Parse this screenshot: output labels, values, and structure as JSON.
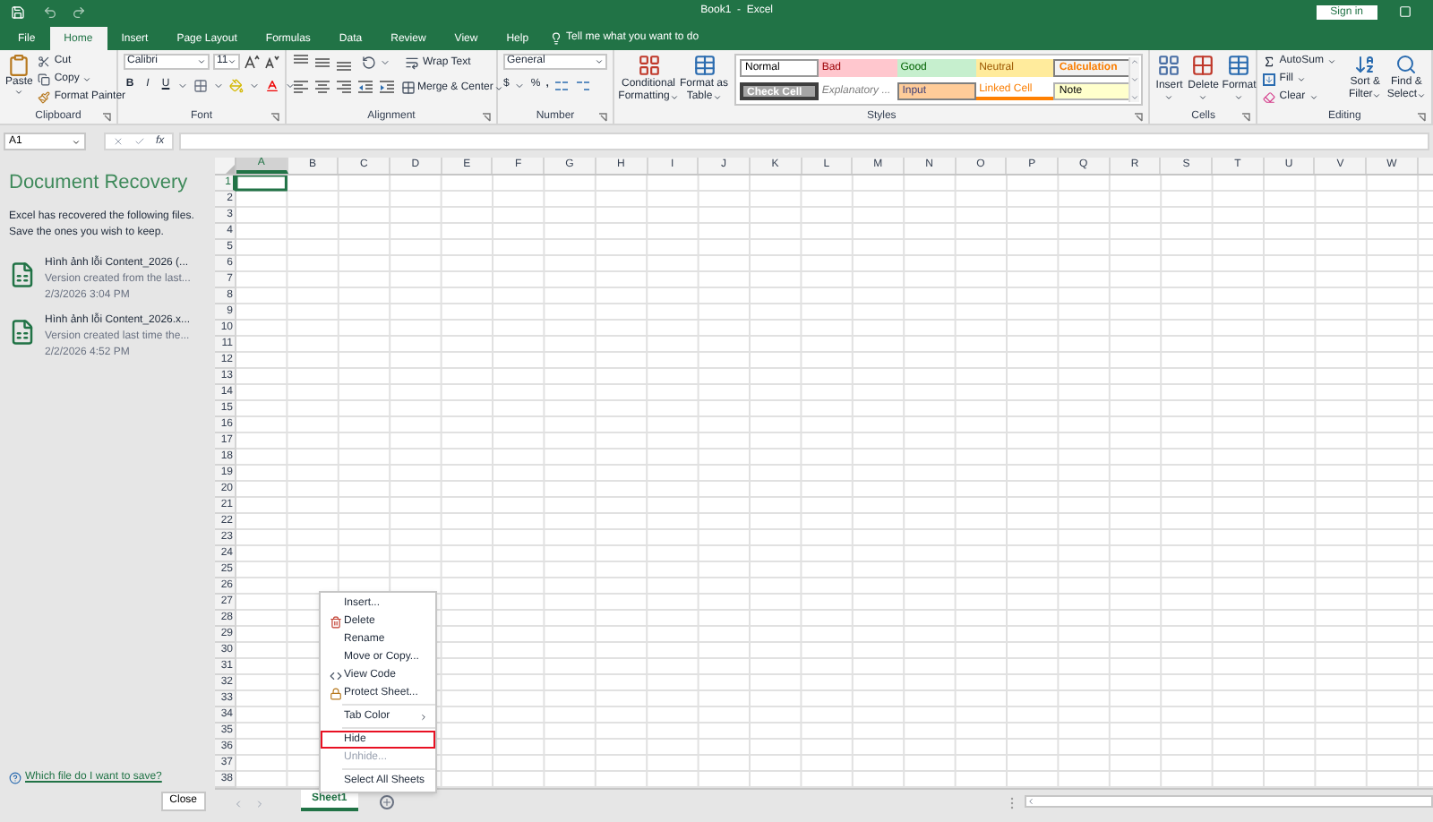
{
  "title_bar": {
    "title": "Book1  -  Excel",
    "sign_in": "Sign in"
  },
  "menu_tabs": [
    {
      "label": "File",
      "selected": false
    },
    {
      "label": "Home",
      "selected": true
    },
    {
      "label": "Insert",
      "selected": false
    },
    {
      "label": "Page Layout",
      "selected": false
    },
    {
      "label": "Formulas",
      "selected": false
    },
    {
      "label": "Data",
      "selected": false
    },
    {
      "label": "Review",
      "selected": false
    },
    {
      "label": "View",
      "selected": false
    },
    {
      "label": "Help",
      "selected": false
    }
  ],
  "tell_me": "Tell me what you want to do",
  "ribbon": {
    "clipboard": {
      "label": "Clipboard",
      "paste": "Paste",
      "cut": "Cut",
      "copy": "Copy",
      "format_painter": "Format Painter"
    },
    "font": {
      "label": "Font",
      "font_name": "Calibri",
      "font_size": "11",
      "bold": "B",
      "italic": "I",
      "underline": "U"
    },
    "alignment": {
      "label": "Alignment",
      "wrap_text": "Wrap Text",
      "merge": "Merge & Center"
    },
    "number": {
      "label": "Number",
      "format": "General",
      "currency": "$",
      "percent": "%",
      "comma": ","
    },
    "styles": {
      "label": "Styles",
      "conditional": [
        "Conditional",
        "Formatting"
      ],
      "format_table": [
        "Format as",
        "Table"
      ],
      "cell_styles": [
        {
          "label": "Normal",
          "kind": "normal"
        },
        {
          "label": "Bad",
          "kind": "bad"
        },
        {
          "label": "Good",
          "kind": "good"
        },
        {
          "label": "Neutral",
          "kind": "neutral"
        },
        {
          "label": "Calculation",
          "kind": "calculation"
        },
        {
          "label": "Check Cell",
          "kind": "check"
        },
        {
          "label": "Explanatory ...",
          "kind": "explanatory"
        },
        {
          "label": "Input",
          "kind": "input"
        },
        {
          "label": "Linked Cell",
          "kind": "linked"
        },
        {
          "label": "Note",
          "kind": "note"
        }
      ]
    },
    "cells": {
      "label": "Cells",
      "buttons": [
        {
          "label": "Insert",
          "kind": "insert"
        },
        {
          "label": "Delete",
          "kind": "delete"
        },
        {
          "label": "Format",
          "kind": "format"
        }
      ]
    },
    "editing": {
      "label": "Editing",
      "autosum": "AutoSum",
      "fill": "Fill",
      "clear": "Clear",
      "sort": [
        "Sort &",
        "Filter"
      ],
      "find": [
        "Find &",
        "Select"
      ]
    }
  },
  "formula_bar": {
    "name_box": "A1",
    "fx": "fx"
  },
  "recovery": {
    "title": "Document Recovery",
    "description": "Excel has recovered the following files.  Save the ones you wish to keep.",
    "files": [
      {
        "name": "Hình ảnh lỗi Content_2026 (...",
        "detail": "Version created from the last...",
        "date": "2/3/2026 3:04 PM"
      },
      {
        "name": "Hình ảnh lỗi Content_2026.x...",
        "detail": "Version created last time the...",
        "date": "2/2/2026 4:52 PM"
      }
    ],
    "help_link": "Which file do I want to save?",
    "close": "Close"
  },
  "grid": {
    "columns": [
      {
        "label": "A",
        "selected": true
      },
      {
        "label": "B",
        "selected": false
      },
      {
        "label": "C",
        "selected": false
      },
      {
        "label": "D",
        "selected": false
      },
      {
        "label": "E",
        "selected": false
      },
      {
        "label": "F",
        "selected": false
      },
      {
        "label": "G",
        "selected": false
      },
      {
        "label": "H",
        "selected": false
      },
      {
        "label": "I",
        "selected": false
      },
      {
        "label": "J",
        "selected": false
      },
      {
        "label": "K",
        "selected": false
      },
      {
        "label": "L",
        "selected": false
      },
      {
        "label": "M",
        "selected": false
      },
      {
        "label": "N",
        "selected": false
      },
      {
        "label": "O",
        "selected": false
      },
      {
        "label": "P",
        "selected": false
      },
      {
        "label": "Q",
        "selected": false
      },
      {
        "label": "R",
        "selected": false
      },
      {
        "label": "S",
        "selected": false
      },
      {
        "label": "T",
        "selected": false
      },
      {
        "label": "U",
        "selected": false
      },
      {
        "label": "V",
        "selected": false
      },
      {
        "label": "W",
        "selected": false
      }
    ],
    "rows": [
      {
        "label": "1",
        "selected": true
      },
      {
        "label": "2",
        "selected": false
      },
      {
        "label": "3",
        "selected": false
      },
      {
        "label": "4",
        "selected": false
      },
      {
        "label": "5",
        "selected": false
      },
      {
        "label": "6",
        "selected": false
      },
      {
        "label": "7",
        "selected": false
      },
      {
        "label": "8",
        "selected": false
      },
      {
        "label": "9",
        "selected": false
      },
      {
        "label": "10",
        "selected": false
      },
      {
        "label": "11",
        "selected": false
      },
      {
        "label": "12",
        "selected": false
      },
      {
        "label": "13",
        "selected": false
      },
      {
        "label": "14",
        "selected": false
      },
      {
        "label": "15",
        "selected": false
      },
      {
        "label": "16",
        "selected": false
      },
      {
        "label": "17",
        "selected": false
      },
      {
        "label": "18",
        "selected": false
      },
      {
        "label": "19",
        "selected": false
      },
      {
        "label": "20",
        "selected": false
      },
      {
        "label": "21",
        "selected": false
      },
      {
        "label": "22",
        "selected": false
      },
      {
        "label": "23",
        "selected": false
      },
      {
        "label": "24",
        "selected": false
      },
      {
        "label": "25",
        "selected": false
      },
      {
        "label": "26",
        "selected": false
      },
      {
        "label": "27",
        "selected": false
      },
      {
        "label": "28",
        "selected": false
      },
      {
        "label": "29",
        "selected": false
      },
      {
        "label": "30",
        "selected": false
      },
      {
        "label": "31",
        "selected": false
      },
      {
        "label": "32",
        "selected": false
      },
      {
        "label": "33",
        "selected": false
      },
      {
        "label": "34",
        "selected": false
      },
      {
        "label": "35",
        "selected": false
      },
      {
        "label": "36",
        "selected": false
      },
      {
        "label": "37",
        "selected": false
      },
      {
        "label": "38",
        "selected": false
      }
    ]
  },
  "context_menu": {
    "items": [
      {
        "label": "Insert...",
        "kind": "plain",
        "selected": false,
        "disabled": false,
        "submenu": false
      },
      {
        "label": "Delete",
        "kind": "delete",
        "selected": false,
        "disabled": false,
        "submenu": false
      },
      {
        "label": "Rename",
        "kind": "plain",
        "selected": false,
        "disabled": false,
        "submenu": false
      },
      {
        "label": "Move or Copy...",
        "kind": "plain",
        "selected": false,
        "disabled": false,
        "submenu": false
      },
      {
        "label": "View Code",
        "kind": "code",
        "selected": false,
        "disabled": false,
        "submenu": false
      },
      {
        "label": "Protect Sheet...",
        "kind": "protect",
        "selected": false,
        "disabled": false,
        "submenu": false
      },
      {
        "label": "Tab Color",
        "kind": "plain",
        "selected": false,
        "disabled": false,
        "submenu": true
      },
      {
        "label": "Hide",
        "kind": "plain",
        "selected": true,
        "disabled": false,
        "submenu": false
      },
      {
        "label": "Unhide...",
        "kind": "plain",
        "selected": false,
        "disabled": true,
        "submenu": false
      },
      {
        "label": "Select All Sheets",
        "kind": "plain",
        "selected": false,
        "disabled": false,
        "submenu": false
      }
    ]
  },
  "sheet_tabs": [
    {
      "label": "Sheet1",
      "selected": true
    }
  ]
}
